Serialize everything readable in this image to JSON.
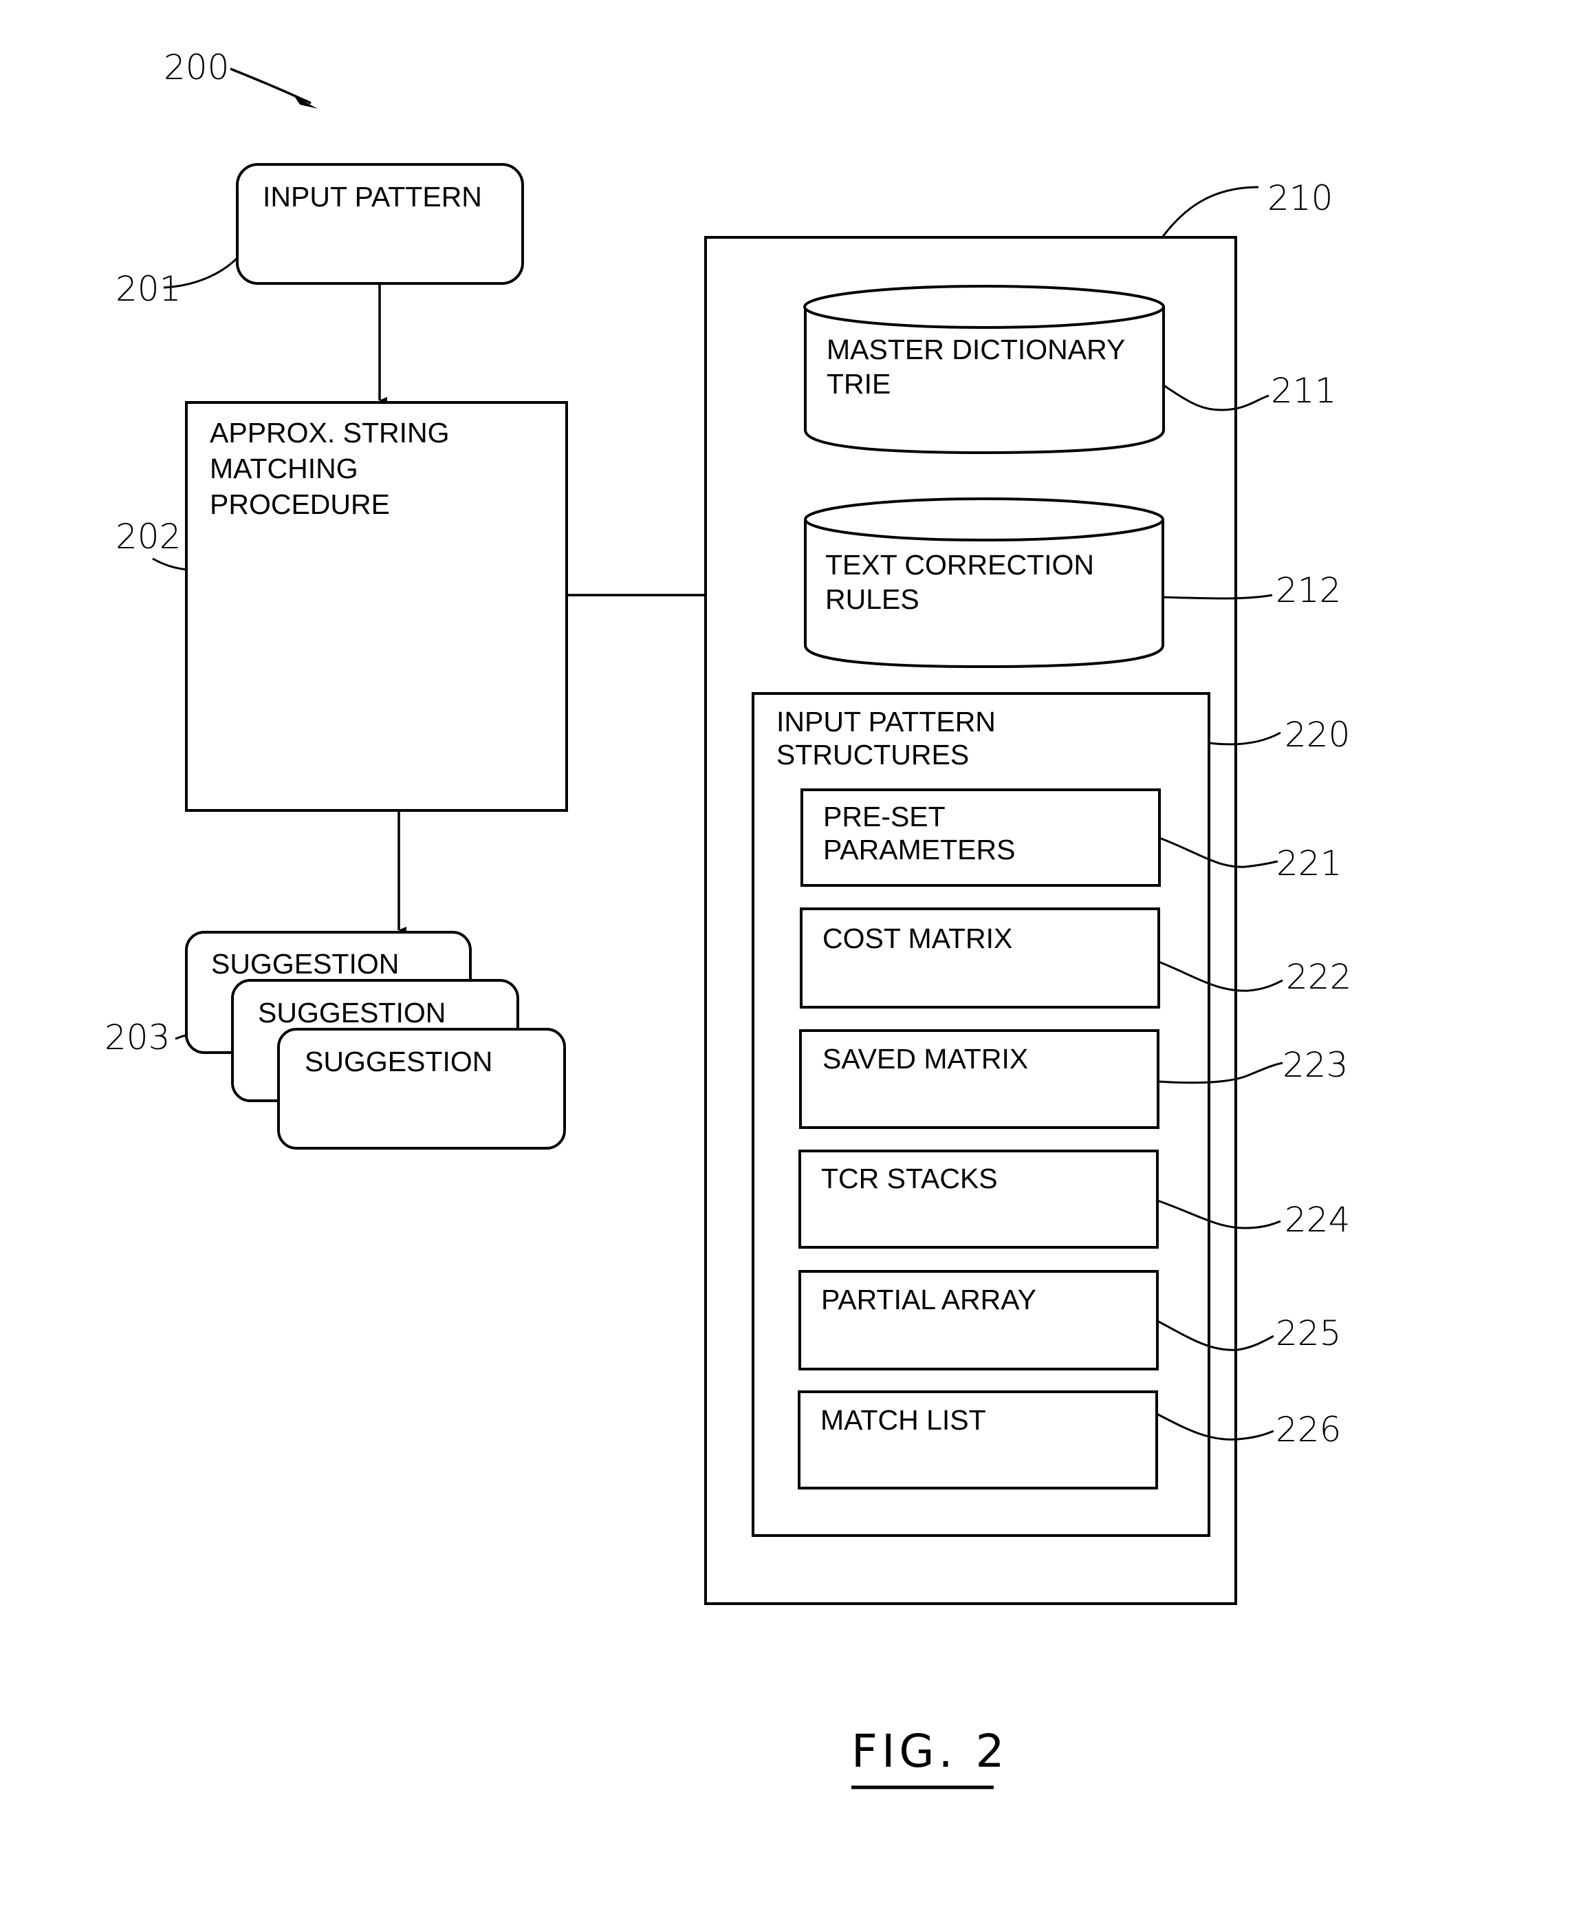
{
  "figure": {
    "caption": "FIG. 2",
    "ref_main": "200"
  },
  "input_pattern": {
    "ref": "201",
    "label": "INPUT PATTERN"
  },
  "procedure": {
    "ref": "202",
    "lines": [
      "APPROX. STRING",
      "MATCHING",
      "PROCEDURE"
    ]
  },
  "suggestions": {
    "ref": "203",
    "items": [
      "SUGGESTION",
      "SUGGESTION",
      "SUGGESTION"
    ]
  },
  "data_store": {
    "ref": "210",
    "master_dictionary": {
      "ref": "211",
      "lines": [
        "MASTER DICTIONARY",
        "TRIE"
      ]
    },
    "text_correction": {
      "ref": "212",
      "lines": [
        "TEXT CORRECTION",
        "RULES"
      ]
    },
    "input_pattern_structures": {
      "ref": "220",
      "lines": [
        "INPUT PATTERN",
        "STRUCTURES"
      ],
      "items": [
        {
          "ref": "221",
          "lines": [
            "PRE-SET",
            "PARAMETERS"
          ]
        },
        {
          "ref": "222",
          "lines": [
            "COST MATRIX"
          ]
        },
        {
          "ref": "223",
          "lines": [
            "SAVED MATRIX"
          ]
        },
        {
          "ref": "224",
          "lines": [
            "TCR STACKS"
          ]
        },
        {
          "ref": "225",
          "lines": [
            "PARTIAL ARRAY"
          ]
        },
        {
          "ref": "226",
          "lines": [
            "MATCH LIST"
          ]
        }
      ]
    }
  }
}
